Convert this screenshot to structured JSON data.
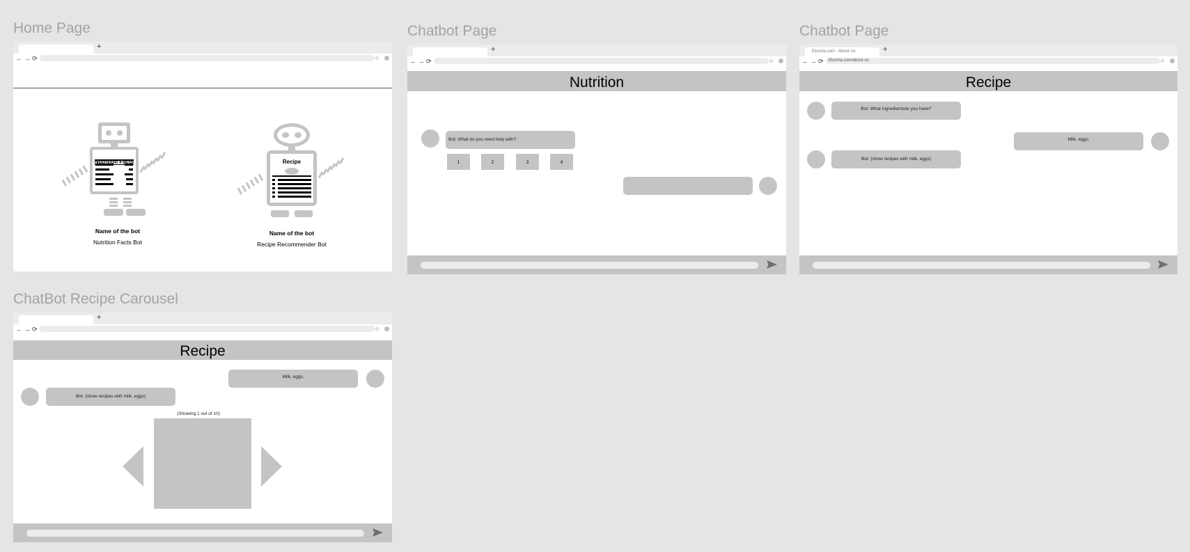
{
  "frames": {
    "home": {
      "title": "Home Page",
      "bots": [
        {
          "board_title": "Nutrition Facts",
          "name_label": "Name of the bot",
          "description": "Nutrition Facts Bot",
          "icon": "nutrition-robot-icon"
        },
        {
          "board_title": "Recipe",
          "name_label": "Name of the bot",
          "description": "Recipe Recommender Bot",
          "icon": "recipe-robot-icon"
        }
      ]
    },
    "nutrition_chat": {
      "title": "Chatbot Page",
      "header": "Nutrition",
      "bot_message": "Bot: What do you need help with?",
      "options": [
        "1",
        "2",
        "3",
        "4"
      ],
      "user_message": ""
    },
    "recipe_chat": {
      "title": "Chatbot Page",
      "tab_title": "Ekosha.com - About Us",
      "url": "Ekosha.com/about-us",
      "header": "Recipe",
      "bot_message_1": "Bot: What ingrediantsdo you have?",
      "user_message": "Milk, eggs,",
      "bot_message_2": "Bot: (show recipes with milk, eggs)"
    },
    "carousel": {
      "title": "ChatBot Recipe Carousel",
      "header": "Recipe",
      "user_message": "Milk, eggs,",
      "bot_message": "Bot: (show recipes with milk, eggs)",
      "counter": "(Showing 1 out of 10)"
    }
  },
  "browser": {
    "nav_glyphs": "← → ⟳",
    "new_tab": "+",
    "star": "☆"
  },
  "colors": {
    "canvas": "#e5e5e5",
    "placeholder_gray": "#c4c4c4",
    "frame_title": "#a3a3a3"
  },
  "icons": [
    "back-icon",
    "forward-icon",
    "reload-icon",
    "star-icon",
    "send-icon",
    "prev-arrow-icon",
    "next-arrow-icon"
  ]
}
